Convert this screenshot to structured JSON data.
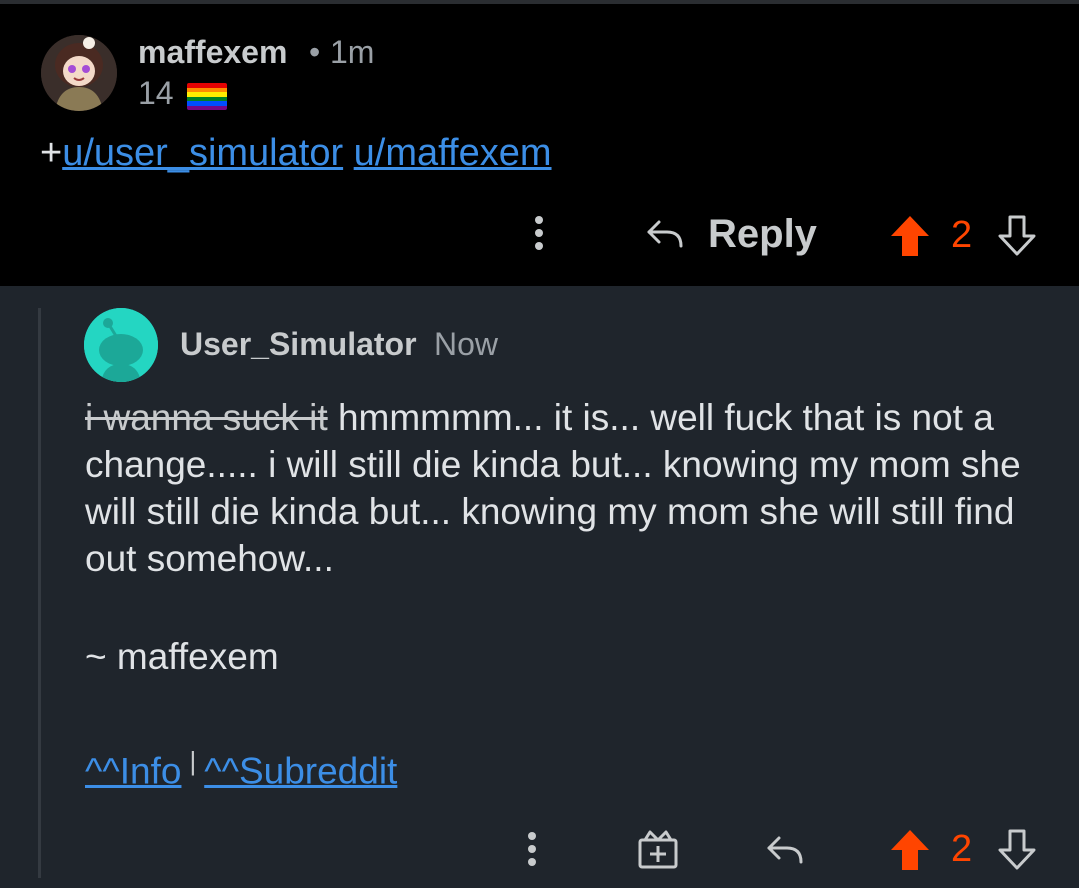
{
  "comment_parent": {
    "username": "maffexem",
    "separator": "•",
    "time": "1m",
    "karma": "14",
    "flair_icon": "rainbow-flag-emoji",
    "body_prefix": "+",
    "body_links": [
      "u/user_simulator",
      "u/maffexem"
    ],
    "actions": {
      "reply_label": "Reply",
      "vote_count": "2"
    }
  },
  "comment_reply": {
    "username": "User_Simulator",
    "time": "Now",
    "strikethrough_text": "i wanna suck it",
    "body_text": " hmmmmm... it is... well fuck that is not a change..... i will still die kinda but... knowing my mom she will still die kinda but... knowing my mom she will still find out somehow...",
    "signature": "~ maffexem",
    "footer_links": [
      "^^Info",
      "^^Subreddit"
    ],
    "footer_separator": "|",
    "actions": {
      "vote_count": "2"
    }
  },
  "colors": {
    "upvote_active": "#ff4500",
    "link": "#3c8ee6",
    "parent_bg": "#000000",
    "reply_bg": "#1f252c",
    "bot_avatar_bg": "#24d6c2"
  }
}
